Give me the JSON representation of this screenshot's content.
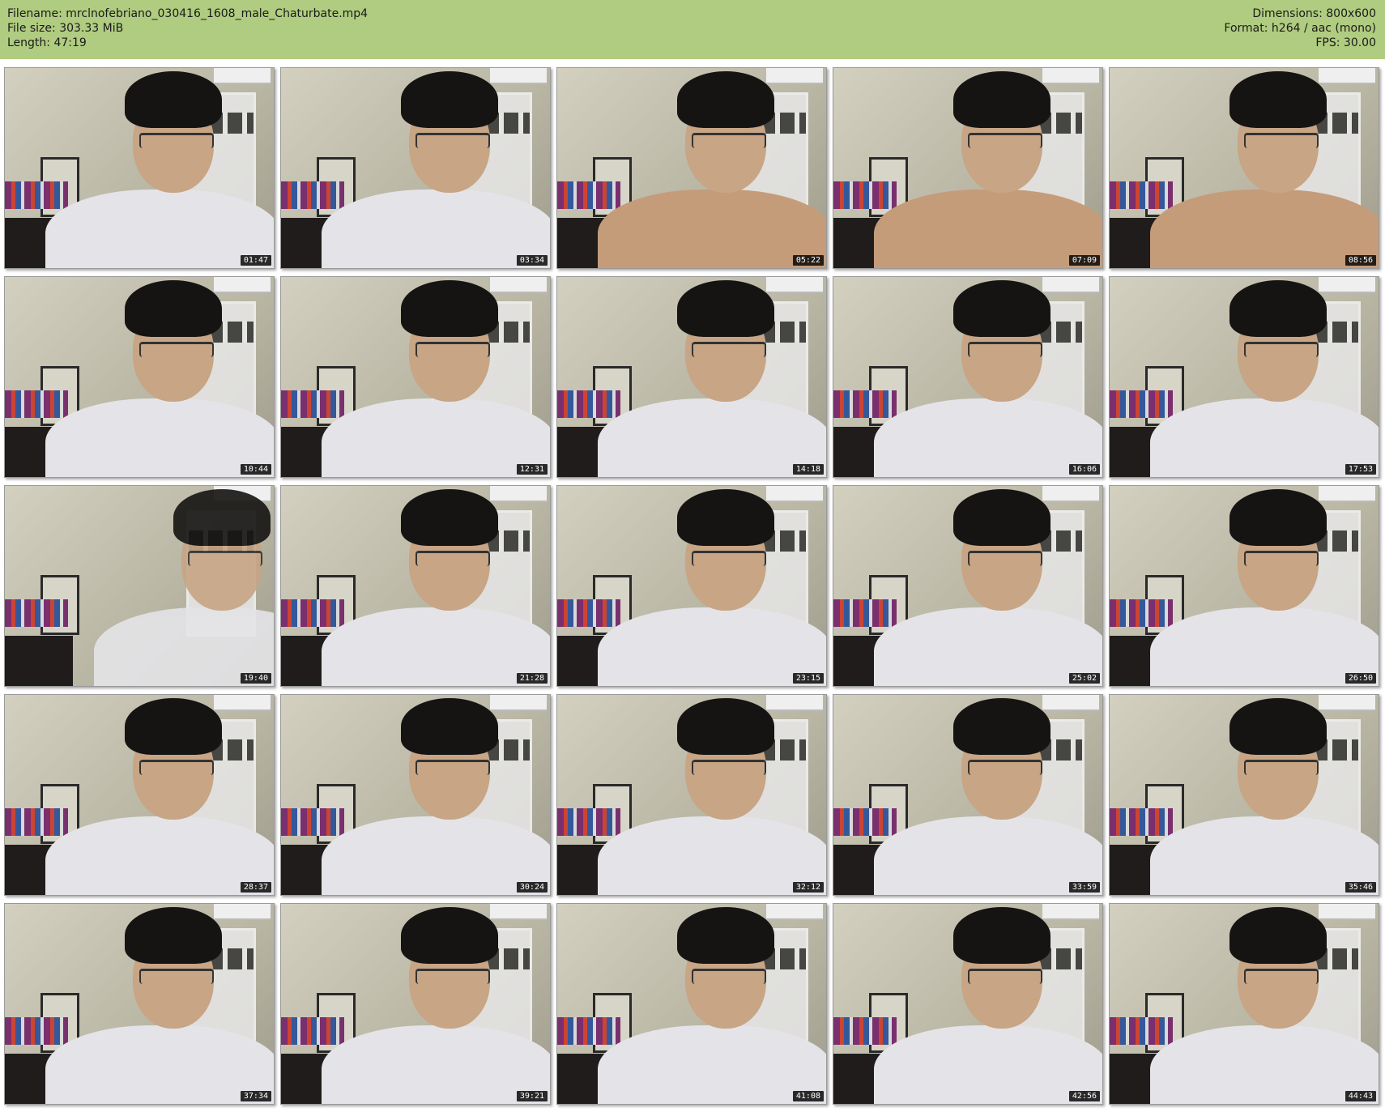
{
  "header": {
    "filename": "Filename: mrclnofebriano_030416_1608_male_Chaturbate.mp4",
    "filesize": "File size: 303.33 MiB",
    "length": "Length: 47:19",
    "dimensions": "Dimensions: 800x600",
    "format": "Format: h264 / aac (mono)",
    "fps": "FPS: 30.00"
  },
  "colors": {
    "header_bg": "#b0cc80",
    "stamp_bg": "#111111"
  },
  "thumbnails": [
    {
      "time": "01:47"
    },
    {
      "time": "03:34"
    },
    {
      "time": "05:22"
    },
    {
      "time": "07:09"
    },
    {
      "time": "08:56"
    },
    {
      "time": "10:44"
    },
    {
      "time": "12:31"
    },
    {
      "time": "14:18"
    },
    {
      "time": "16:06"
    },
    {
      "time": "17:53"
    },
    {
      "time": "19:40"
    },
    {
      "time": "21:28"
    },
    {
      "time": "23:15"
    },
    {
      "time": "25:02"
    },
    {
      "time": "26:50"
    },
    {
      "time": "28:37"
    },
    {
      "time": "30:24"
    },
    {
      "time": "32:12"
    },
    {
      "time": "33:59"
    },
    {
      "time": "35:46"
    },
    {
      "time": "37:34"
    },
    {
      "time": "39:21"
    },
    {
      "time": "41:08"
    },
    {
      "time": "42:56"
    },
    {
      "time": "44:43"
    }
  ]
}
